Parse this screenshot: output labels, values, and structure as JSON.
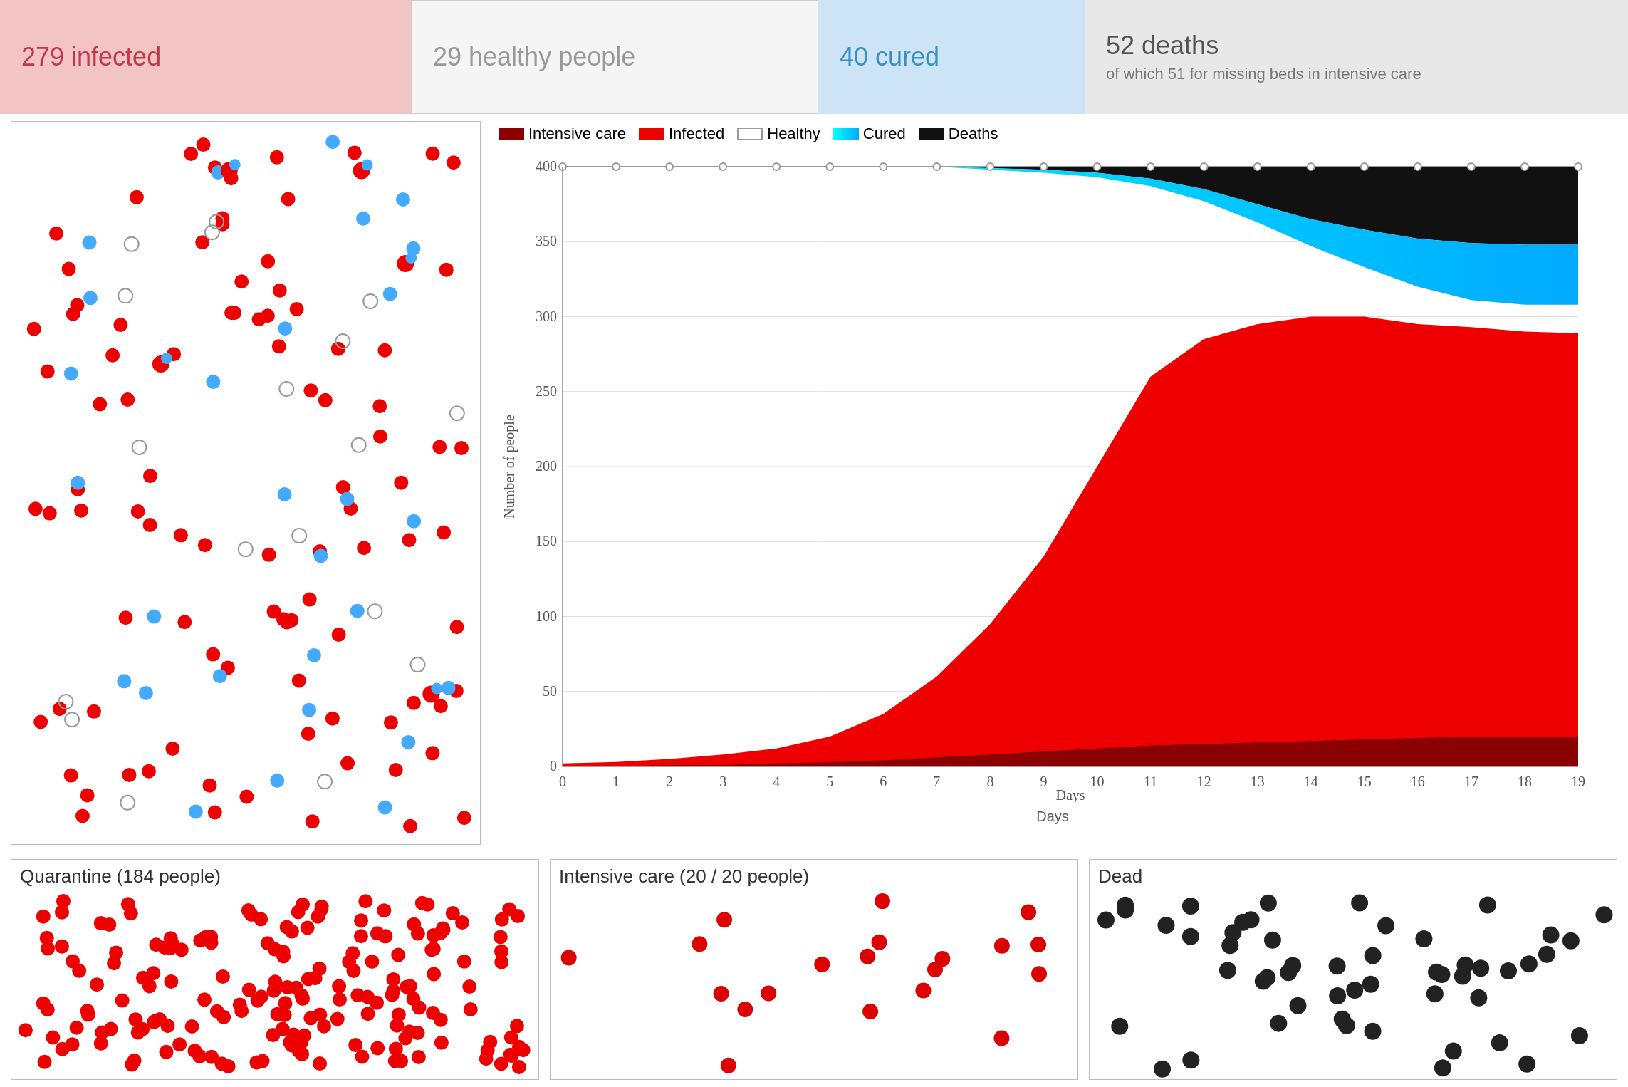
{
  "stats": {
    "infected": {
      "label": "279 infected",
      "bg": "#f2c4c4",
      "color": "#c0394b"
    },
    "healthy": {
      "label": "29 healthy people",
      "bg": "#f5f5f5",
      "color": "#999"
    },
    "cured": {
      "label": "40 cured",
      "bg": "#cce4f5",
      "color": "#3a8fc0"
    },
    "deaths": {
      "label": "52 deaths",
      "subtitle": "of which 51 for missing beds in intensive care",
      "bg": "#e8e8e8",
      "color": "#555"
    }
  },
  "legend": {
    "items": [
      {
        "id": "intensive",
        "label": "Intensive care",
        "color": "#8b0000"
      },
      {
        "id": "infected",
        "label": "Infected",
        "color": "#e00000"
      },
      {
        "id": "healthy",
        "label": "Healthy",
        "color": "#999",
        "outline": true
      },
      {
        "id": "cured",
        "label": "Cured",
        "color": "#00cfff"
      },
      {
        "id": "deaths",
        "label": "Deaths",
        "color": "#111111"
      }
    ]
  },
  "chart": {
    "y_axis_label": "Number of people",
    "x_axis_label": "Days",
    "y_max": 400,
    "x_max": 19
  },
  "bottom_panels": {
    "quarantine": {
      "title": "Quarantine (184 people)"
    },
    "intensive": {
      "title": "Intensive care (20 / 20 people)"
    },
    "dead": {
      "title": "Dead"
    }
  }
}
